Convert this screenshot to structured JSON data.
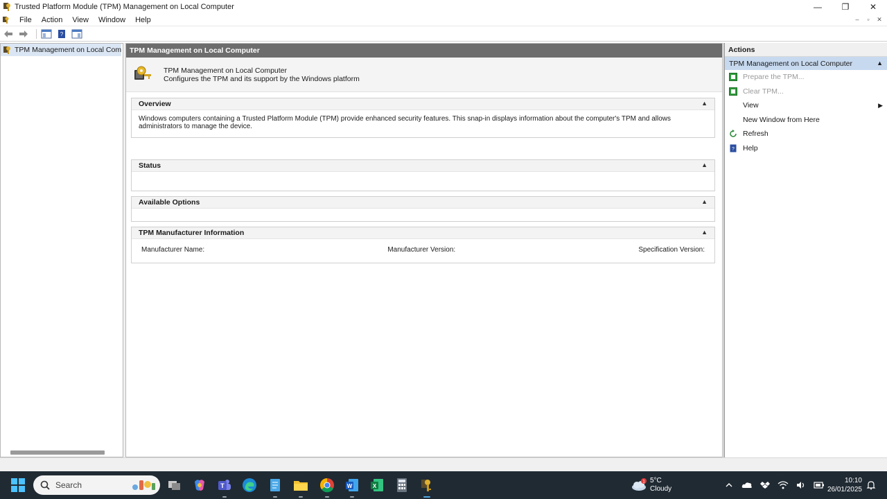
{
  "window": {
    "title": "Trusted Platform Module (TPM) Management on Local Computer",
    "minimize": "—",
    "maximize": "❐",
    "close": "✕"
  },
  "menu": {
    "items": [
      "File",
      "Action",
      "View",
      "Window",
      "Help"
    ],
    "mdi_minimize": "–",
    "mdi_restore": "▫",
    "mdi_close": "✕"
  },
  "tree": {
    "root_label": "TPM Management on Local Compu"
  },
  "center": {
    "header": "TPM Management on Local Computer",
    "intro_title": "TPM Management on Local Computer",
    "intro_subtitle": "Configures the TPM and its support by the Windows platform",
    "sections": {
      "overview": {
        "title": "Overview",
        "toggle": "▲",
        "body": "Windows computers containing a Trusted Platform Module (TPM) provide enhanced security features. This snap-in displays information about the computer's TPM and allows administrators to manage the device."
      },
      "status": {
        "title": "Status",
        "toggle": "▲"
      },
      "options": {
        "title": "Available Options",
        "toggle": "▲"
      },
      "manufacturer": {
        "title": "TPM Manufacturer Information",
        "toggle": "▲",
        "name_label": "Manufacturer Name:",
        "version_label": "Manufacturer Version:",
        "spec_label": "Specification Version:"
      }
    }
  },
  "actions": {
    "title": "Actions",
    "group_label": "TPM Management on Local Computer",
    "group_caret": "▲",
    "items": [
      {
        "label": "Prepare the TPM...",
        "icon": "green-square-icon",
        "enabled": false
      },
      {
        "label": "Clear TPM...",
        "icon": "green-square-icon",
        "enabled": false
      },
      {
        "label": "View",
        "icon": "",
        "enabled": true,
        "submenu_arrow": "▶"
      },
      {
        "label": "New Window from Here",
        "icon": "",
        "enabled": true
      },
      {
        "label": "Refresh",
        "icon": "refresh-icon",
        "enabled": true
      },
      {
        "label": "Help",
        "icon": "help-book-icon",
        "enabled": true
      }
    ]
  },
  "taskbar": {
    "search_placeholder": "Search",
    "weather_temp": "5°C",
    "weather_desc": "Cloudy",
    "weather_badge": "1",
    "time": "10:10",
    "date": "26/01/2025"
  },
  "colors": {
    "pane_header": "#6d6d6d",
    "selection": "#c7d9ef",
    "taskbar": "#202a33",
    "accent": "#4fa8e0"
  }
}
